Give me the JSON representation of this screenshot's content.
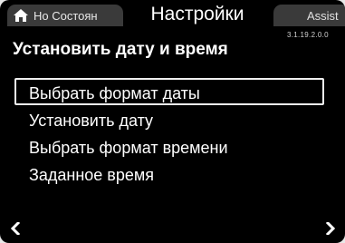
{
  "tabs": {
    "home_label": "Но Состоян",
    "settings_label": "Настройки",
    "assist_label": "Assist"
  },
  "version": "3.1.19.2.0.0",
  "page_title": "Установить дату и время",
  "menu": {
    "items": [
      {
        "label": "Выбрать формат даты",
        "selected": true
      },
      {
        "label": "Установить дату",
        "selected": false
      },
      {
        "label": "Выбрать формат времени",
        "selected": false
      },
      {
        "label": "Заданное время",
        "selected": false
      }
    ]
  },
  "icons": {
    "home": "home-icon",
    "nav_left": "chevron-left-icon",
    "nav_right": "chevron-right-icon"
  },
  "colors": {
    "background": "#000000",
    "tab_inactive": "#3a3a3a",
    "text": "#ffffff",
    "selection_border": "#f0f0f0"
  }
}
